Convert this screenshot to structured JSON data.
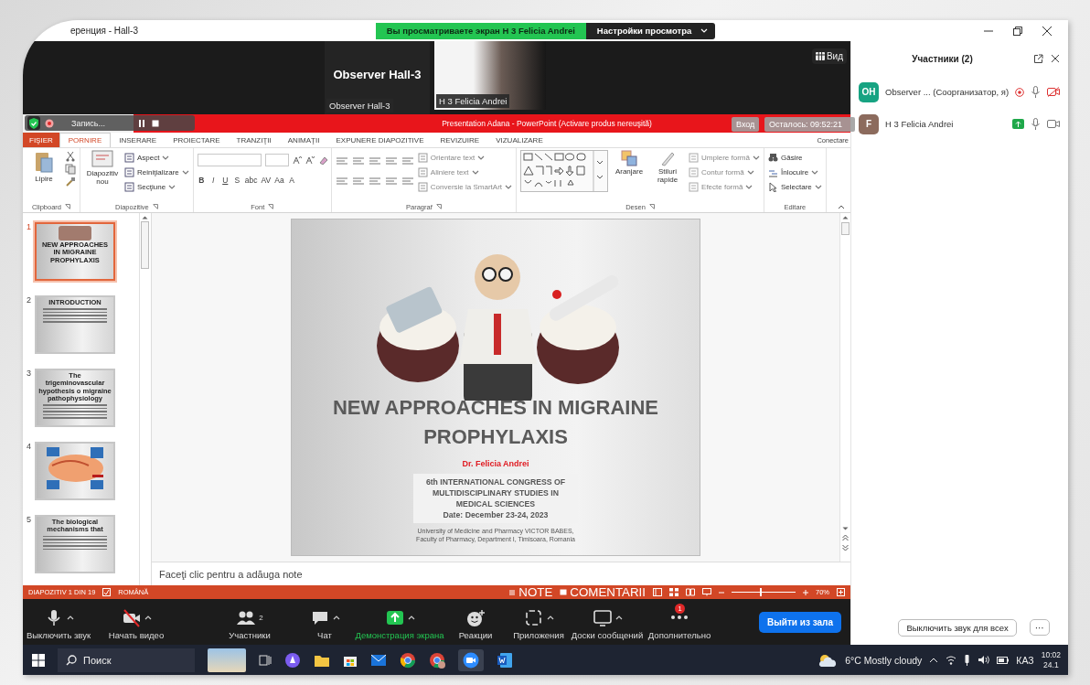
{
  "window": {
    "title": "еренция - Hall-3"
  },
  "share_banner": {
    "text": "Вы просматриваете экран H 3 Felicia Andrei",
    "view_settings": "Настройки просмотра"
  },
  "video_strip": {
    "tiles": [
      {
        "kind": "name",
        "title": "Observer  Hall-3",
        "label": "Observer  Hall-3"
      },
      {
        "kind": "video",
        "label": "H 3 Felicia Andrei"
      }
    ],
    "view_button": "Вид"
  },
  "powerpoint": {
    "title": "Presentation Adana -  PowerPoint (Activare produs nereuşită)",
    "recording": "Запись...",
    "sign_in": "Вход",
    "remaining": "Осталось: 09:52:21",
    "account": "Conectare",
    "tabs": [
      {
        "label": "FIŞIER",
        "kind": "file",
        "selected": false
      },
      {
        "label": "PORNIRE",
        "kind": "tab",
        "selected": true
      },
      {
        "label": "INSERARE",
        "kind": "tab",
        "selected": false
      },
      {
        "label": "PROIECTARE",
        "kind": "tab",
        "selected": false
      },
      {
        "label": "TRANZIŢII",
        "kind": "tab",
        "selected": false
      },
      {
        "label": "ANIMAŢII",
        "kind": "tab",
        "selected": false
      },
      {
        "label": "EXPUNERE DIAPOZITIVE",
        "kind": "tab",
        "selected": false
      },
      {
        "label": "REVIZUIRE",
        "kind": "tab",
        "selected": false
      },
      {
        "label": "VIZUALIZARE",
        "kind": "tab",
        "selected": false
      }
    ],
    "ribbon": [
      {
        "name": "Clipboard",
        "kind": "clipboard",
        "big": [
          "Lipire"
        ]
      },
      {
        "name": "Diapozitive",
        "kind": "slides",
        "big": [
          "Diapozitiv nou"
        ],
        "small": [
          "Aspect",
          "Reiniţializare",
          "Secţiune"
        ]
      },
      {
        "name": "Font",
        "kind": "font",
        "buttons": [
          "B",
          "I",
          "U",
          "S",
          "abc",
          "AV",
          "Aa",
          "A"
        ]
      },
      {
        "name": "Paragraf",
        "kind": "paragraph",
        "small": [
          "Orientare text",
          "Aliniere text",
          "Conversie la SmartArt"
        ]
      },
      {
        "name": "Desen",
        "kind": "drawing",
        "big": [
          "Aranjare",
          "Stiluri rapide"
        ],
        "small": [
          "Umplere formă",
          "Contur formă",
          "Efecte formă"
        ]
      },
      {
        "name": "Editare",
        "kind": "editing",
        "small": [
          "Găsire",
          "Înlocuire",
          "Selectare"
        ]
      }
    ],
    "slides": [
      {
        "number": "1",
        "kind": "title",
        "selected": true,
        "title": "NEW APPROACHES IN MIGRAINE PROPHYLAXIS"
      },
      {
        "number": "2",
        "kind": "bullets",
        "selected": false,
        "title": "INTRODUCTION"
      },
      {
        "number": "3",
        "kind": "bullets",
        "selected": false,
        "title": "The trigeminovascular hypothesis o migraine pathophysiology"
      },
      {
        "number": "4",
        "kind": "diagram",
        "selected": false
      },
      {
        "number": "5",
        "kind": "bullets",
        "selected": false,
        "title": "The biological mechanisms that"
      }
    ],
    "slide": {
      "title": "NEW APPROACHES IN MIGRAINE PROPHYLAXIS",
      "author": "Dr. Felicia Andrei",
      "event": [
        "6th INTERNATIONAL CONGRESS OF",
        "MULTIDISCIPLINARY STUDIES IN",
        "MEDICAL SCIENCES",
        "Date: December 23-24, 2023"
      ],
      "affiliation": [
        "University of Medicine and Pharmacy VICTOR BABES,",
        "Faculty of Pharmacy, Department I, Timisoara, Romania"
      ]
    },
    "notes_placeholder": "Faceţi clic pentru a adăuga note",
    "status": {
      "slide": "DIAPOZITIV 1 DIN 19",
      "language": "ROMÂNĂ",
      "notes": "NOTE",
      "comments": "COMENTARII",
      "zoom": "70%",
      "level": 0.45
    }
  },
  "toolbar": {
    "items": [
      {
        "label": "Выключить звук",
        "kind": "mic",
        "off": false,
        "active": false,
        "caret": true
      },
      {
        "label": "Начать видео",
        "kind": "camera",
        "off": true,
        "active": false,
        "caret": true
      },
      {
        "label": "Участники",
        "kind": "people",
        "count": "2",
        "off": false,
        "active": false,
        "caret": false
      },
      {
        "label": "Чат",
        "kind": "chat",
        "off": false,
        "active": false,
        "caret": true
      },
      {
        "label": "Демонстрация экрана",
        "kind": "share",
        "off": false,
        "active": true,
        "caret": true
      },
      {
        "label": "Реакции",
        "kind": "smile",
        "off": false,
        "active": false,
        "caret": false
      },
      {
        "label": "Приложения",
        "kind": "apps",
        "off": false,
        "active": false,
        "caret": true
      },
      {
        "label": "Доски сообщений",
        "kind": "board",
        "off": false,
        "active": false,
        "caret": true
      },
      {
        "label": "Дополнительно",
        "kind": "more",
        "badge": "1",
        "off": false,
        "active": false,
        "caret": false
      }
    ],
    "leave": "Выйти из зала"
  },
  "participants": {
    "title": "Участники (2)",
    "people": [
      {
        "initials": "OH",
        "color": "#17a382",
        "name": "Observer ... (Соорганизатор, я)",
        "recording": true,
        "sharing": false,
        "video_on": false
      },
      {
        "initials": "F",
        "color": "#8c6b5d",
        "name": "H 3 Felicia Andrei",
        "recording": false,
        "sharing": true,
        "video_on": true
      }
    ],
    "mute_all": "Выключить звук для всех",
    "more": "···"
  },
  "taskbar": {
    "search": "Поиск",
    "weather": "6°C Mostly cloudy",
    "language": "КАЗ",
    "time": "10:02",
    "date": "24.1"
  }
}
